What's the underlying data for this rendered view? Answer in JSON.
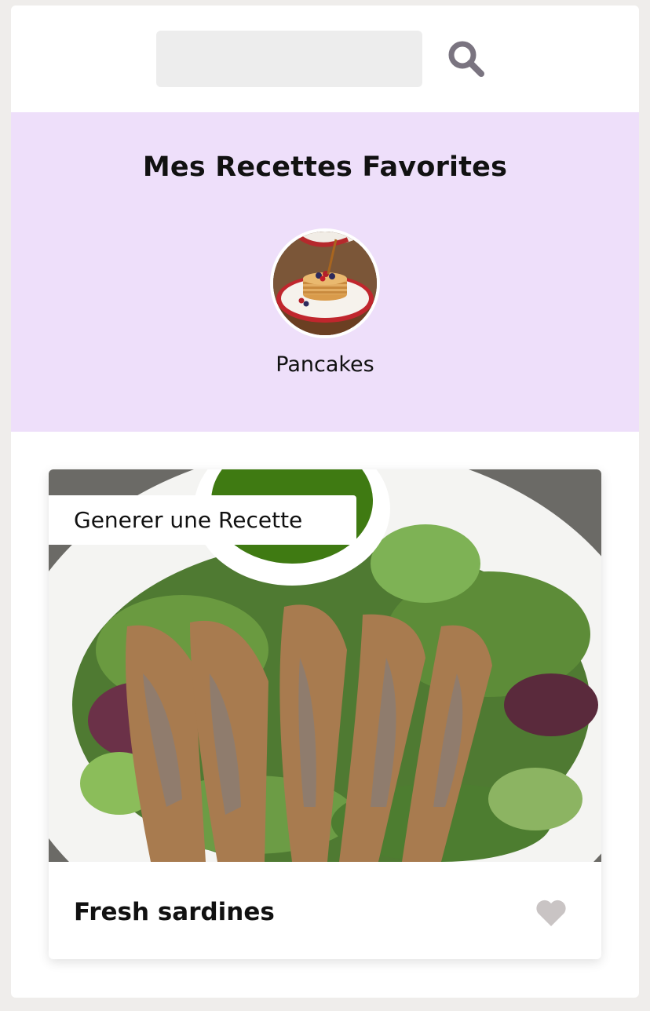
{
  "search": {
    "placeholder": "",
    "value": "",
    "icon": "search-icon"
  },
  "favorites": {
    "title": "Mes Recettes Favorites",
    "items": [
      {
        "label": "Pancakes",
        "image": "pancakes-photo"
      }
    ]
  },
  "card": {
    "tag_label": "Generer une Recette",
    "title": "Fresh sardines",
    "image": "sardines-salad-photo",
    "favorite_icon": "heart-icon",
    "favorited": false
  },
  "colors": {
    "page_bg": "#efedeb",
    "favorites_bg": "#eedffa",
    "search_bg": "#ededed",
    "search_icon": "#7a7480",
    "heart_icon": "#c9c4c4"
  }
}
